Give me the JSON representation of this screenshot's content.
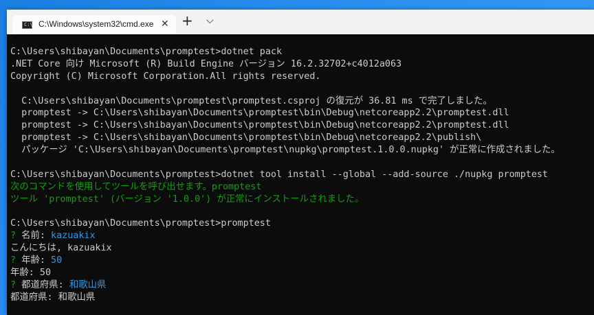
{
  "window": {
    "tab_title": "C:\\Windows\\system32\\cmd.exe",
    "tab_icon_text": "C:\\",
    "close_glyph": "✕",
    "new_tab_glyph": "+",
    "dropdown_glyph": "⌵"
  },
  "console": {
    "lines": [
      {
        "text": "C:\\Users\\shibayan\\Documents\\promptest>dotnet pack",
        "color": "default"
      },
      {
        "text": ".NET Core 向け Microsoft (R) Build Engine バージョン 16.2.32702+c4012a063",
        "color": "default"
      },
      {
        "text": "Copyright (C) Microsoft Corporation.All rights reserved.",
        "color": "default"
      },
      {
        "text": "",
        "color": "default"
      },
      {
        "text": "  C:\\Users\\shibayan\\Documents\\promptest\\promptest.csproj の復元が 36.81 ms で完了しました。",
        "color": "default"
      },
      {
        "text": "  promptest -> C:\\Users\\shibayan\\Documents\\promptest\\bin\\Debug\\netcoreapp2.2\\promptest.dll",
        "color": "default"
      },
      {
        "text": "  promptest -> C:\\Users\\shibayan\\Documents\\promptest\\bin\\Debug\\netcoreapp2.2\\promptest.dll",
        "color": "default"
      },
      {
        "text": "  promptest -> C:\\Users\\shibayan\\Documents\\promptest\\bin\\Debug\\netcoreapp2.2\\publish\\",
        "color": "default"
      },
      {
        "text": "  パッケージ 'C:\\Users\\shibayan\\Documents\\promptest\\nupkg\\promptest.1.0.0.nupkg' が正常に作成されました。",
        "color": "default"
      },
      {
        "text": "",
        "color": "default"
      },
      {
        "text": "C:\\Users\\shibayan\\Documents\\promptest>dotnet tool install --global --add-source ./nupkg promptest",
        "color": "default"
      },
      {
        "text": "次のコマンドを使用してツールを呼び出せます。promptest",
        "color": "green"
      },
      {
        "text": "ツール 'promptest' (バージョン '1.0.0') が正常にインストールされました。",
        "color": "green"
      },
      {
        "text": "",
        "color": "default"
      },
      {
        "text": "C:\\Users\\shibayan\\Documents\\promptest>promptest",
        "color": "default"
      },
      {
        "prefix": "? ",
        "label": "名前: ",
        "value": "kazuakix",
        "color": "prompt"
      },
      {
        "text": "こんにちは, kazuakix",
        "color": "default"
      },
      {
        "prefix": "? ",
        "label": "年齢: ",
        "value": "50",
        "color": "prompt"
      },
      {
        "text": "年齢: 50",
        "color": "default"
      },
      {
        "prefix": "? ",
        "label": "都道府県: ",
        "value": "和歌山県",
        "color": "prompt"
      },
      {
        "text": "都道府県: 和歌山県",
        "color": "default"
      }
    ]
  },
  "colors": {
    "background": "#0c0c0c",
    "default_text": "#cccccc",
    "green": "#13a10e",
    "cyan": "#3a96dd"
  }
}
